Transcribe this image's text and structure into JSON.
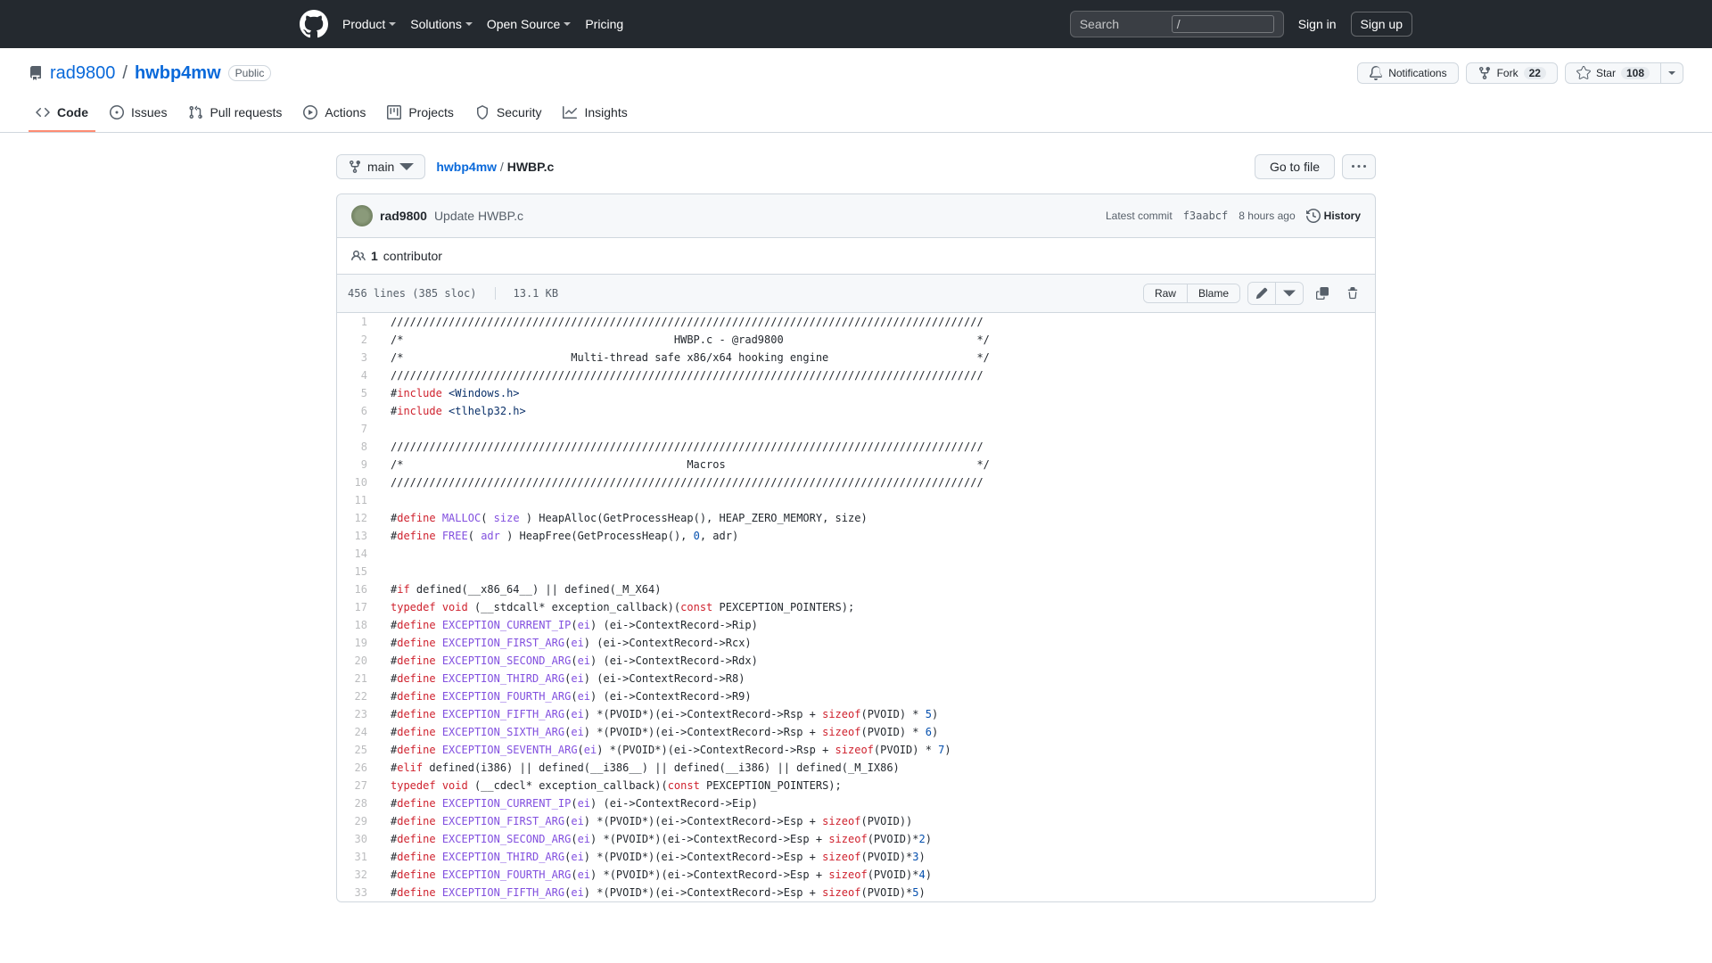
{
  "header": {
    "nav": [
      "Product",
      "Solutions",
      "Open Source",
      "Pricing"
    ],
    "search_placeholder": "Search",
    "slash_key": "/",
    "signin": "Sign in",
    "signup": "Sign up"
  },
  "repo": {
    "owner": "rad9800",
    "name": "hwbp4mw",
    "visibility": "Public",
    "actions": {
      "notifications": "Notifications",
      "fork": "Fork",
      "fork_count": "22",
      "star": "Star",
      "star_count": "108"
    }
  },
  "tabs": [
    {
      "label": "Code",
      "active": true
    },
    {
      "label": "Issues"
    },
    {
      "label": "Pull requests"
    },
    {
      "label": "Actions"
    },
    {
      "label": "Projects"
    },
    {
      "label": "Security"
    },
    {
      "label": "Insights"
    }
  ],
  "breadcrumb": {
    "branch": "main",
    "repo_link": "hwbp4mw",
    "file": "HWBP.c",
    "goto": "Go to file"
  },
  "commit": {
    "author": "rad9800",
    "message": "Update HWBP.c",
    "latest_label": "Latest commit",
    "sha": "f3aabcf",
    "time": "8 hours ago",
    "history": "History"
  },
  "contributors": {
    "count": "1",
    "label": " contributor"
  },
  "file": {
    "lines_info": "456 lines (385 sloc)",
    "size_info": "13.1 KB",
    "raw": "Raw",
    "blame": "Blame"
  },
  "code": [
    {
      "n": 1,
      "tokens": [
        {
          "t": "txt",
          "v": "////////////////////////////////////////////////////////////////////////////////////////////"
        }
      ]
    },
    {
      "n": 2,
      "tokens": [
        {
          "t": "txt",
          "v": "/*                                          HWBP.c - @rad9800                              */"
        }
      ]
    },
    {
      "n": 3,
      "tokens": [
        {
          "t": "txt",
          "v": "/*                          Multi-thread safe x86/x64 hooking engine                       */"
        }
      ]
    },
    {
      "n": 4,
      "tokens": [
        {
          "t": "txt",
          "v": "////////////////////////////////////////////////////////////////////////////////////////////"
        }
      ]
    },
    {
      "n": 5,
      "tokens": [
        {
          "t": "txt",
          "v": "#"
        },
        {
          "t": "pp",
          "v": "include"
        },
        {
          "t": "txt",
          "v": " "
        },
        {
          "t": "str",
          "v": "<Windows.h>"
        }
      ]
    },
    {
      "n": 6,
      "tokens": [
        {
          "t": "txt",
          "v": "#"
        },
        {
          "t": "pp",
          "v": "include"
        },
        {
          "t": "txt",
          "v": " "
        },
        {
          "t": "str",
          "v": "<tlhelp32.h>"
        }
      ]
    },
    {
      "n": 7,
      "tokens": []
    },
    {
      "n": 8,
      "tokens": [
        {
          "t": "txt",
          "v": "////////////////////////////////////////////////////////////////////////////////////////////"
        }
      ]
    },
    {
      "n": 9,
      "tokens": [
        {
          "t": "txt",
          "v": "/*                                            Macros                                       */"
        }
      ]
    },
    {
      "n": 10,
      "tokens": [
        {
          "t": "txt",
          "v": "////////////////////////////////////////////////////////////////////////////////////////////"
        }
      ]
    },
    {
      "n": 11,
      "tokens": []
    },
    {
      "n": 12,
      "tokens": [
        {
          "t": "txt",
          "v": "#"
        },
        {
          "t": "pp",
          "v": "define"
        },
        {
          "t": "txt",
          "v": " "
        },
        {
          "t": "mac",
          "v": "MALLOC"
        },
        {
          "t": "txt",
          "v": "( "
        },
        {
          "t": "fn",
          "v": "size"
        },
        {
          "t": "txt",
          "v": " ) HeapAlloc(GetProcessHeap(), HEAP_ZERO_MEMORY, size)"
        }
      ]
    },
    {
      "n": 13,
      "tokens": [
        {
          "t": "txt",
          "v": "#"
        },
        {
          "t": "pp",
          "v": "define"
        },
        {
          "t": "txt",
          "v": " "
        },
        {
          "t": "mac",
          "v": "FREE"
        },
        {
          "t": "txt",
          "v": "( "
        },
        {
          "t": "fn",
          "v": "adr"
        },
        {
          "t": "txt",
          "v": " ) HeapFree(GetProcessHeap(), "
        },
        {
          "t": "num",
          "v": "0"
        },
        {
          "t": "txt",
          "v": ", adr)"
        }
      ]
    },
    {
      "n": 14,
      "tokens": []
    },
    {
      "n": 15,
      "tokens": []
    },
    {
      "n": 16,
      "tokens": [
        {
          "t": "txt",
          "v": "#"
        },
        {
          "t": "pp",
          "v": "if"
        },
        {
          "t": "txt",
          "v": " defined(__x86_64__) || defined(_M_X64)"
        }
      ]
    },
    {
      "n": 17,
      "tokens": [
        {
          "t": "kw",
          "v": "typedef"
        },
        {
          "t": "txt",
          "v": " "
        },
        {
          "t": "kw",
          "v": "void"
        },
        {
          "t": "txt",
          "v": " (__stdcall* exception_callback)("
        },
        {
          "t": "kw",
          "v": "const"
        },
        {
          "t": "txt",
          "v": " PEXCEPTION_POINTERS);"
        }
      ]
    },
    {
      "n": 18,
      "tokens": [
        {
          "t": "txt",
          "v": "#"
        },
        {
          "t": "pp",
          "v": "define"
        },
        {
          "t": "txt",
          "v": " "
        },
        {
          "t": "mac",
          "v": "EXCEPTION_CURRENT_IP"
        },
        {
          "t": "txt",
          "v": "("
        },
        {
          "t": "fn",
          "v": "ei"
        },
        {
          "t": "txt",
          "v": ") (ei->ContextRecord->Rip)"
        }
      ]
    },
    {
      "n": 19,
      "tokens": [
        {
          "t": "txt",
          "v": "#"
        },
        {
          "t": "pp",
          "v": "define"
        },
        {
          "t": "txt",
          "v": " "
        },
        {
          "t": "mac",
          "v": "EXCEPTION_FIRST_ARG"
        },
        {
          "t": "txt",
          "v": "("
        },
        {
          "t": "fn",
          "v": "ei"
        },
        {
          "t": "txt",
          "v": ") (ei->ContextRecord->Rcx)"
        }
      ]
    },
    {
      "n": 20,
      "tokens": [
        {
          "t": "txt",
          "v": "#"
        },
        {
          "t": "pp",
          "v": "define"
        },
        {
          "t": "txt",
          "v": " "
        },
        {
          "t": "mac",
          "v": "EXCEPTION_SECOND_ARG"
        },
        {
          "t": "txt",
          "v": "("
        },
        {
          "t": "fn",
          "v": "ei"
        },
        {
          "t": "txt",
          "v": ") (ei->ContextRecord->Rdx)"
        }
      ]
    },
    {
      "n": 21,
      "tokens": [
        {
          "t": "txt",
          "v": "#"
        },
        {
          "t": "pp",
          "v": "define"
        },
        {
          "t": "txt",
          "v": " "
        },
        {
          "t": "mac",
          "v": "EXCEPTION_THIRD_ARG"
        },
        {
          "t": "txt",
          "v": "("
        },
        {
          "t": "fn",
          "v": "ei"
        },
        {
          "t": "txt",
          "v": ") (ei->ContextRecord->R8)"
        }
      ]
    },
    {
      "n": 22,
      "tokens": [
        {
          "t": "txt",
          "v": "#"
        },
        {
          "t": "pp",
          "v": "define"
        },
        {
          "t": "txt",
          "v": " "
        },
        {
          "t": "mac",
          "v": "EXCEPTION_FOURTH_ARG"
        },
        {
          "t": "txt",
          "v": "("
        },
        {
          "t": "fn",
          "v": "ei"
        },
        {
          "t": "txt",
          "v": ") (ei->ContextRecord->R9)"
        }
      ]
    },
    {
      "n": 23,
      "tokens": [
        {
          "t": "txt",
          "v": "#"
        },
        {
          "t": "pp",
          "v": "define"
        },
        {
          "t": "txt",
          "v": " "
        },
        {
          "t": "mac",
          "v": "EXCEPTION_FIFTH_ARG"
        },
        {
          "t": "txt",
          "v": "("
        },
        {
          "t": "fn",
          "v": "ei"
        },
        {
          "t": "txt",
          "v": ") *(PVOID*)(ei->ContextRecord->Rsp + "
        },
        {
          "t": "kw",
          "v": "sizeof"
        },
        {
          "t": "txt",
          "v": "(PVOID) * "
        },
        {
          "t": "num",
          "v": "5"
        },
        {
          "t": "txt",
          "v": ")"
        }
      ]
    },
    {
      "n": 24,
      "tokens": [
        {
          "t": "txt",
          "v": "#"
        },
        {
          "t": "pp",
          "v": "define"
        },
        {
          "t": "txt",
          "v": " "
        },
        {
          "t": "mac",
          "v": "EXCEPTION_SIXTH_ARG"
        },
        {
          "t": "txt",
          "v": "("
        },
        {
          "t": "fn",
          "v": "ei"
        },
        {
          "t": "txt",
          "v": ") *(PVOID*)(ei->ContextRecord->Rsp + "
        },
        {
          "t": "kw",
          "v": "sizeof"
        },
        {
          "t": "txt",
          "v": "(PVOID) * "
        },
        {
          "t": "num",
          "v": "6"
        },
        {
          "t": "txt",
          "v": ")"
        }
      ]
    },
    {
      "n": 25,
      "tokens": [
        {
          "t": "txt",
          "v": "#"
        },
        {
          "t": "pp",
          "v": "define"
        },
        {
          "t": "txt",
          "v": " "
        },
        {
          "t": "mac",
          "v": "EXCEPTION_SEVENTH_ARG"
        },
        {
          "t": "txt",
          "v": "("
        },
        {
          "t": "fn",
          "v": "ei"
        },
        {
          "t": "txt",
          "v": ") *(PVOID*)(ei->ContextRecord->Rsp + "
        },
        {
          "t": "kw",
          "v": "sizeof"
        },
        {
          "t": "txt",
          "v": "(PVOID) * "
        },
        {
          "t": "num",
          "v": "7"
        },
        {
          "t": "txt",
          "v": ")"
        }
      ]
    },
    {
      "n": 26,
      "tokens": [
        {
          "t": "txt",
          "v": "#"
        },
        {
          "t": "pp",
          "v": "elif"
        },
        {
          "t": "txt",
          "v": " defined(i386) || defined(__i386__) || defined(__i386) || defined(_M_IX86)"
        }
      ]
    },
    {
      "n": 27,
      "tokens": [
        {
          "t": "kw",
          "v": "typedef"
        },
        {
          "t": "txt",
          "v": " "
        },
        {
          "t": "kw",
          "v": "void"
        },
        {
          "t": "txt",
          "v": " (__cdecl* exception_callback)("
        },
        {
          "t": "kw",
          "v": "const"
        },
        {
          "t": "txt",
          "v": " PEXCEPTION_POINTERS);"
        }
      ]
    },
    {
      "n": 28,
      "tokens": [
        {
          "t": "txt",
          "v": "#"
        },
        {
          "t": "pp",
          "v": "define"
        },
        {
          "t": "txt",
          "v": " "
        },
        {
          "t": "mac",
          "v": "EXCEPTION_CURRENT_IP"
        },
        {
          "t": "txt",
          "v": "("
        },
        {
          "t": "fn",
          "v": "ei"
        },
        {
          "t": "txt",
          "v": ") (ei->ContextRecord->Eip)"
        }
      ]
    },
    {
      "n": 29,
      "tokens": [
        {
          "t": "txt",
          "v": "#"
        },
        {
          "t": "pp",
          "v": "define"
        },
        {
          "t": "txt",
          "v": " "
        },
        {
          "t": "mac",
          "v": "EXCEPTION_FIRST_ARG"
        },
        {
          "t": "txt",
          "v": "("
        },
        {
          "t": "fn",
          "v": "ei"
        },
        {
          "t": "txt",
          "v": ") *(PVOID*)(ei->ContextRecord->Esp + "
        },
        {
          "t": "kw",
          "v": "sizeof"
        },
        {
          "t": "txt",
          "v": "(PVOID))"
        }
      ]
    },
    {
      "n": 30,
      "tokens": [
        {
          "t": "txt",
          "v": "#"
        },
        {
          "t": "pp",
          "v": "define"
        },
        {
          "t": "txt",
          "v": " "
        },
        {
          "t": "mac",
          "v": "EXCEPTION_SECOND_ARG"
        },
        {
          "t": "txt",
          "v": "("
        },
        {
          "t": "fn",
          "v": "ei"
        },
        {
          "t": "txt",
          "v": ") *(PVOID*)(ei->ContextRecord->Esp + "
        },
        {
          "t": "kw",
          "v": "sizeof"
        },
        {
          "t": "txt",
          "v": "(PVOID)*"
        },
        {
          "t": "num",
          "v": "2"
        },
        {
          "t": "txt",
          "v": ")"
        }
      ]
    },
    {
      "n": 31,
      "tokens": [
        {
          "t": "txt",
          "v": "#"
        },
        {
          "t": "pp",
          "v": "define"
        },
        {
          "t": "txt",
          "v": " "
        },
        {
          "t": "mac",
          "v": "EXCEPTION_THIRD_ARG"
        },
        {
          "t": "txt",
          "v": "("
        },
        {
          "t": "fn",
          "v": "ei"
        },
        {
          "t": "txt",
          "v": ") *(PVOID*)(ei->ContextRecord->Esp + "
        },
        {
          "t": "kw",
          "v": "sizeof"
        },
        {
          "t": "txt",
          "v": "(PVOID)*"
        },
        {
          "t": "num",
          "v": "3"
        },
        {
          "t": "txt",
          "v": ")"
        }
      ]
    },
    {
      "n": 32,
      "tokens": [
        {
          "t": "txt",
          "v": "#"
        },
        {
          "t": "pp",
          "v": "define"
        },
        {
          "t": "txt",
          "v": " "
        },
        {
          "t": "mac",
          "v": "EXCEPTION_FOURTH_ARG"
        },
        {
          "t": "txt",
          "v": "("
        },
        {
          "t": "fn",
          "v": "ei"
        },
        {
          "t": "txt",
          "v": ") *(PVOID*)(ei->ContextRecord->Esp + "
        },
        {
          "t": "kw",
          "v": "sizeof"
        },
        {
          "t": "txt",
          "v": "(PVOID)*"
        },
        {
          "t": "num",
          "v": "4"
        },
        {
          "t": "txt",
          "v": ")"
        }
      ]
    },
    {
      "n": 33,
      "tokens": [
        {
          "t": "txt",
          "v": "#"
        },
        {
          "t": "pp",
          "v": "define"
        },
        {
          "t": "txt",
          "v": " "
        },
        {
          "t": "mac",
          "v": "EXCEPTION_FIFTH_ARG"
        },
        {
          "t": "txt",
          "v": "("
        },
        {
          "t": "fn",
          "v": "ei"
        },
        {
          "t": "txt",
          "v": ") *(PVOID*)(ei->ContextRecord->Esp + "
        },
        {
          "t": "kw",
          "v": "sizeof"
        },
        {
          "t": "txt",
          "v": "(PVOID)*"
        },
        {
          "t": "num",
          "v": "5"
        },
        {
          "t": "txt",
          "v": ")"
        }
      ]
    }
  ]
}
